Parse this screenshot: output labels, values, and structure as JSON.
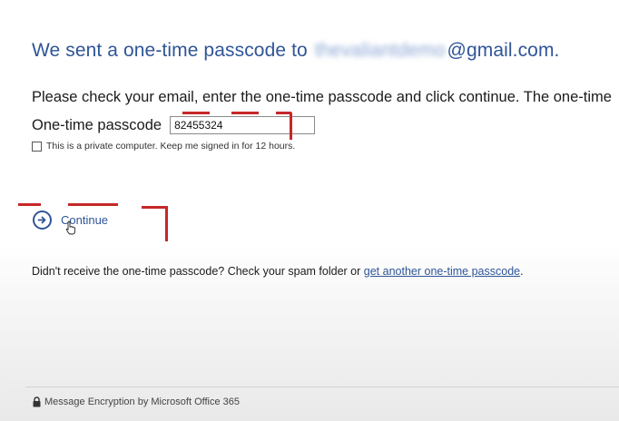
{
  "heading": {
    "prefix": "We sent a one-time passcode to",
    "redacted_email_user": "thevaliantdemo",
    "email_domain": "@gmail.com."
  },
  "instructions": "Please check your email, enter the one-time passcode and click continue. The one-time",
  "otp": {
    "label": "One-time passcode",
    "value": "82455324"
  },
  "remember": {
    "label": "This is a private computer. Keep me signed in for 12 hours.",
    "checked": false
  },
  "continue": {
    "label": "Continue",
    "icon": "arrow-right-circle-icon"
  },
  "resend": {
    "text": "Didn't receive the one-time passcode? Check your spam folder or",
    "link_label": "get another one-time passcode",
    "suffix": "."
  },
  "footer": {
    "icon": "lock-icon",
    "text": "Message Encryption by Microsoft Office 365"
  },
  "colors": {
    "accent": "#2f5597",
    "annotation": "#c62828"
  }
}
